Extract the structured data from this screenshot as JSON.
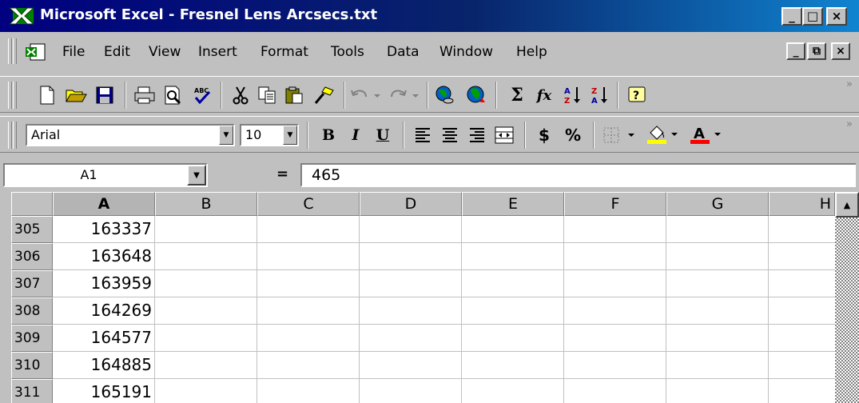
{
  "window": {
    "title": "Microsoft Excel - Fresnel Lens Arcsecs.txt",
    "minimize": "_",
    "maximize": "□",
    "close": "×"
  },
  "menu": {
    "items": [
      "File",
      "Edit",
      "View",
      "Insert",
      "Format",
      "Tools",
      "Data",
      "Window",
      "Help"
    ],
    "doc_minimize": "_",
    "doc_restore": "⧉",
    "doc_close": "×"
  },
  "standard_toolbar": {
    "buttons": [
      "new-icon",
      "open-icon",
      "save-icon",
      "print-icon",
      "print-preview-icon",
      "spelling-icon",
      "cut-icon",
      "copy-icon",
      "paste-icon",
      "format-painter-icon",
      "undo-icon",
      "redo-icon",
      "insert-hyperlink-icon",
      "web-toolbar-icon",
      "autosum-icon",
      "paste-function-icon",
      "sort-ascending-icon",
      "sort-descending-icon",
      "office-assistant-icon"
    ],
    "autosum_label": "Σ",
    "function_label": "fx"
  },
  "formatting_toolbar": {
    "font": "Arial",
    "size": "10",
    "bold": "B",
    "italic": "I",
    "underline": "U",
    "currency": "$",
    "percent": "%",
    "font_color_label": "A",
    "fill_color": "#ffff00",
    "font_color": "#ff0000"
  },
  "formula_bar": {
    "name_box": "A1",
    "equals": "=",
    "content": "465"
  },
  "grid": {
    "columns": [
      "A",
      "B",
      "C",
      "D",
      "E",
      "F",
      "G",
      "H"
    ],
    "rows": [
      {
        "num": "305",
        "a": "163337"
      },
      {
        "num": "306",
        "a": "163648"
      },
      {
        "num": "307",
        "a": "163959"
      },
      {
        "num": "308",
        "a": "164269"
      },
      {
        "num": "309",
        "a": "164577"
      },
      {
        "num": "310",
        "a": "164885"
      },
      {
        "num": "311",
        "a": "165191"
      }
    ]
  }
}
